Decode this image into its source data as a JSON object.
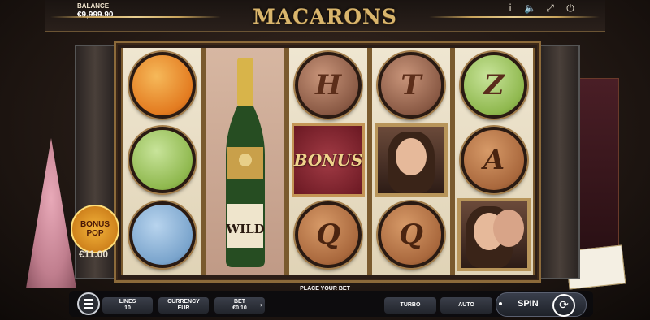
{
  "header": {
    "balance_label": "BALANCE",
    "balance_value": "€9,999.90",
    "title": "MACARONS",
    "icons": [
      "info-icon",
      "sound-icon",
      "fullscreen-icon",
      "power-icon"
    ]
  },
  "reels": [
    [
      "orange-vanilla-macaron",
      "pistachio-macaron",
      "blueberry-macaron"
    ],
    [
      "champagne-wild"
    ],
    [
      "H-macaron",
      "bonus-symbol",
      "Q-macaron"
    ],
    [
      "T-macaron",
      "woman-portrait",
      "Q-macaron"
    ],
    [
      "pistachio-Z-macaron",
      "A-macaron",
      "couple-portrait"
    ]
  ],
  "symbols": {
    "h_letter": "H",
    "t_letter": "T",
    "q_letter": "Q",
    "z_letter": "Z",
    "a_letter": "A",
    "bonus_text": "BONUS",
    "wild_text": "WILD"
  },
  "bonus_pop": {
    "line1": "BONUS",
    "line2": "POP",
    "value": "€11.00"
  },
  "controls": {
    "place_bet": "PLACE YOUR BET",
    "lines_label": "LINES",
    "lines_value": "10",
    "currency_label": "CURRENCY",
    "currency_value": "EUR",
    "bet_label": "BET",
    "bet_value": "€0.10",
    "turbo_label": "TURBO",
    "auto_label": "AUTO",
    "spin_label": "SPIN"
  }
}
